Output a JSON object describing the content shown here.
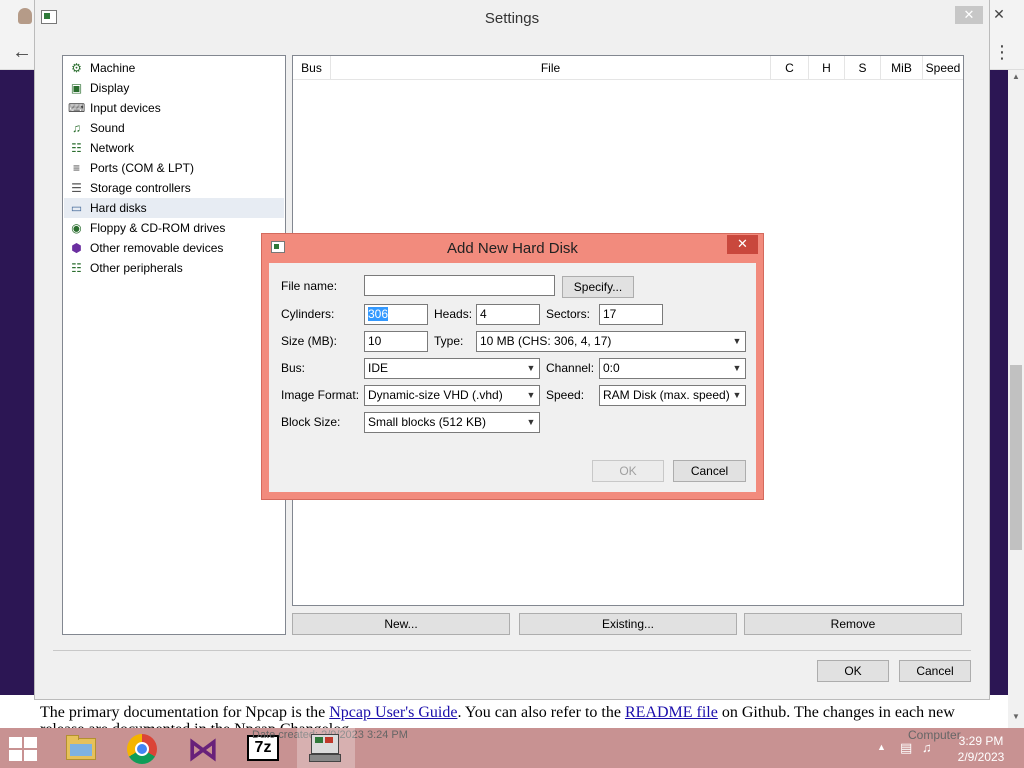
{
  "browser": {
    "back_glyph": "←",
    "menu_glyph": "⋮",
    "close_glyph": "✕",
    "doc_text_1": "The primary documentation for Npcap is the ",
    "doc_link_1": "Npcap User's Guide",
    "doc_text_2": ". You can also refer to the ",
    "doc_link_2": "README file",
    "doc_text_3": " on Github. The changes in each new",
    "doc_line2": "release are documented in the Npcap Changelog."
  },
  "settings": {
    "title": "Settings",
    "close_glyph": "✕",
    "tree": [
      {
        "label": "Machine",
        "icon": "machine-icon",
        "glyph": "⚙",
        "color": "#2b6e2f"
      },
      {
        "label": "Display",
        "icon": "display-icon",
        "glyph": "▣",
        "color": "#2b6e2f"
      },
      {
        "label": "Input devices",
        "icon": "input-devices-icon",
        "glyph": "⌨",
        "color": "#444"
      },
      {
        "label": "Sound",
        "icon": "sound-icon",
        "glyph": "♫",
        "color": "#2b6e2f"
      },
      {
        "label": "Network",
        "icon": "network-icon",
        "glyph": "☷",
        "color": "#2b6e2f"
      },
      {
        "label": "Ports (COM & LPT)",
        "icon": "ports-icon",
        "glyph": "≡",
        "color": "#444"
      },
      {
        "label": "Storage controllers",
        "icon": "storage-controllers-icon",
        "glyph": "☰",
        "color": "#555"
      },
      {
        "label": "Hard disks",
        "icon": "hard-disk-icon",
        "glyph": "▭",
        "color": "#4a6e9c"
      },
      {
        "label": "Floppy & CD-ROM drives",
        "icon": "floppy-cdrom-icon",
        "glyph": "◉",
        "color": "#2b6e2f"
      },
      {
        "label": "Other removable devices",
        "icon": "removable-devices-icon",
        "glyph": "⬢",
        "color": "#6b2fa0"
      },
      {
        "label": "Other peripherals",
        "icon": "peripherals-icon",
        "glyph": "☷",
        "color": "#2b6e2f"
      }
    ],
    "columns": [
      "Bus",
      "File",
      "C",
      "H",
      "S",
      "MiB",
      "Speed"
    ],
    "new_label": "New...",
    "existing_label": "Existing...",
    "remove_label": "Remove",
    "ok_label": "OK",
    "cancel_label": "Cancel"
  },
  "dialog": {
    "title": "Add New Hard Disk",
    "close_glyph": "✕",
    "file_name_label": "File name:",
    "file_name_value": "",
    "specify_label": "Specify...",
    "cylinders_label": "Cylinders:",
    "cylinders_value": "306",
    "heads_label": "Heads:",
    "heads_value": "4",
    "sectors_label": "Sectors:",
    "sectors_value": "17",
    "size_label": "Size (MB):",
    "size_value": "10",
    "type_label": "Type:",
    "type_value": "10 MB (CHS: 306, 4, 17)",
    "bus_label": "Bus:",
    "bus_value": "IDE",
    "channel_label": "Channel:",
    "channel_value": "0:0",
    "image_format_label": "Image Format:",
    "image_format_value": "Dynamic-size VHD (.vhd)",
    "speed_label": "Speed:",
    "speed_value": "RAM Disk (max. speed)",
    "block_size_label": "Block Size:",
    "block_size_value": "Small blocks (512 KB)",
    "ok_label": "OK",
    "cancel_label": "Cancel"
  },
  "taskbar": {
    "apps": [
      {
        "name": "file-explorer-icon",
        "label": "File Explorer"
      },
      {
        "name": "chrome-icon",
        "label": "Chrome"
      },
      {
        "name": "visual-studio-icon",
        "label": "Visual Studio"
      },
      {
        "name": "7zip-icon",
        "label": "7z"
      },
      {
        "name": "emulator-icon",
        "label": "Emulator"
      }
    ],
    "seven_zip_text": "7z",
    "date_created": "Date created: 2/9/2023 3:24 PM",
    "tray_computer": "Computer",
    "clock_time": "3:29 PM",
    "clock_date": "2/9/2023"
  }
}
